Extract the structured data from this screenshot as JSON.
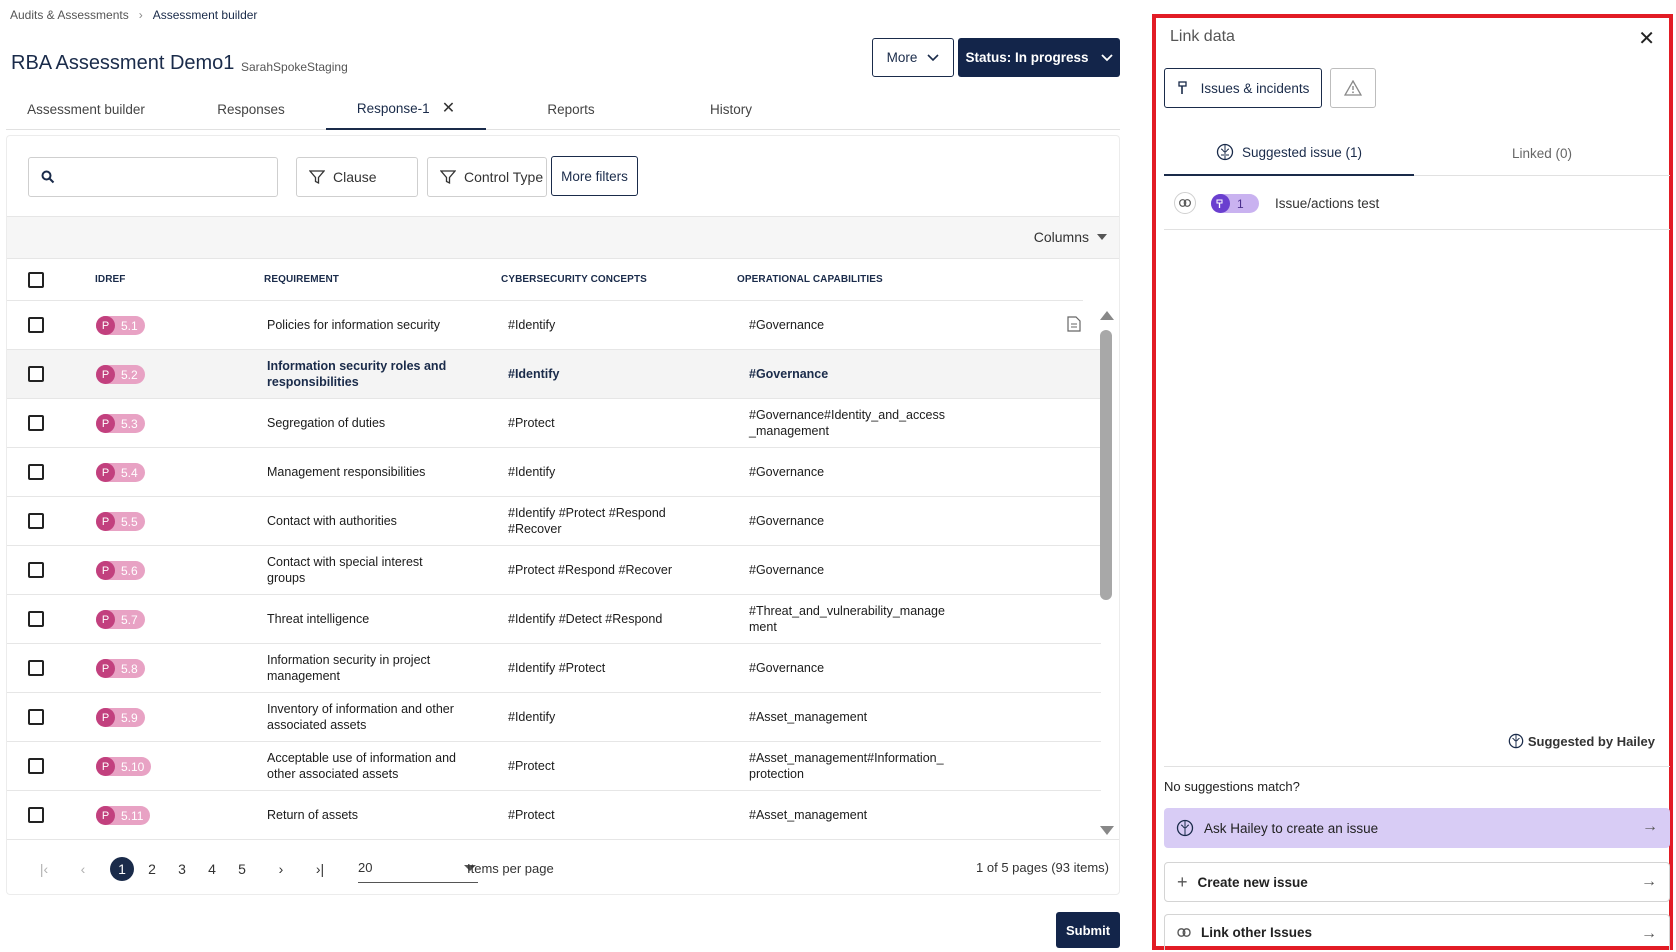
{
  "breadcrumb": {
    "parent": "Audits & Assessments",
    "current": "Assessment builder"
  },
  "page": {
    "title": "RBA Assessment Demo1",
    "subtitle": "SarahSpokeStaging"
  },
  "header_buttons": {
    "more": "More",
    "status": "Status: In progress"
  },
  "tabs": [
    "Assessment builder",
    "Responses",
    "Response-1",
    "Reports",
    "History"
  ],
  "filters": {
    "search_placeholder": "",
    "clause": "Clause",
    "control_type": "Control Type",
    "more_filters": "More filters",
    "columns": "Columns"
  },
  "table": {
    "headers": [
      "IDREF",
      "REQUIREMENT",
      "CYBERSECURITY CONCEPTS",
      "OPERATIONAL CAPABILITIES"
    ],
    "rows": [
      {
        "id": "5.1",
        "req": "Policies for information security",
        "cyber": "#Identify",
        "ops": "#Governance"
      },
      {
        "id": "5.2",
        "req": "Information security roles and responsibilities",
        "cyber": "#Identify",
        "ops": "#Governance"
      },
      {
        "id": "5.3",
        "req": "Segregation of duties",
        "cyber": "#Protect",
        "ops": "#Governance#Identity_and_access_management"
      },
      {
        "id": "5.4",
        "req": "Management responsibilities",
        "cyber": "#Identify",
        "ops": "#Governance"
      },
      {
        "id": "5.5",
        "req": "Contact with authorities",
        "cyber": "#Identify #Protect #Respond #Recover",
        "ops": "#Governance"
      },
      {
        "id": "5.6",
        "req": "Contact with special interest groups",
        "cyber": "#Protect #Respond #Recover",
        "ops": "#Governance"
      },
      {
        "id": "5.7",
        "req": "Threat intelligence",
        "cyber": "#Identify #Detect #Respond",
        "ops": "#Threat_and_vulnerability_management"
      },
      {
        "id": "5.8",
        "req": "Information security in project management",
        "cyber": "#Identify #Protect",
        "ops": "#Governance"
      },
      {
        "id": "5.9",
        "req": "Inventory of information and other associated assets",
        "cyber": "#Identify",
        "ops": "#Asset_management"
      },
      {
        "id": "5.10",
        "req": "Acceptable use of information and other associated assets",
        "cyber": "#Protect",
        "ops": "#Asset_management#Information_protection"
      },
      {
        "id": "5.11",
        "req": "Return of assets",
        "cyber": "#Protect",
        "ops": "#Asset_management"
      }
    ],
    "id_prefix": "P"
  },
  "pagination": {
    "pages": [
      "1",
      "2",
      "3",
      "4",
      "5"
    ],
    "current": "1",
    "per_page": "20",
    "per_page_label": "Items per page",
    "info": "1 of 5 pages (93 items)"
  },
  "submit": "Submit",
  "panel": {
    "title": "Link data",
    "issues_btn": "Issues & incidents",
    "tabs": {
      "suggested": "Suggested issue (1)",
      "linked": "Linked (0)"
    },
    "suggestion": {
      "count": "1",
      "name": "Issue/actions test"
    },
    "suggested_by": "Suggested by Hailey",
    "no_match": "No suggestions match?",
    "actions": {
      "hailey": "Ask Hailey to create an issue",
      "create": "Create new issue",
      "link": "Link other Issues"
    }
  },
  "colors": {
    "navy": "#13254a",
    "pill_pink": "#e8a2c4",
    "pill_dark": "#c2407e",
    "hailey_purple": "#d8ccf5",
    "panel_border": "#e21c25"
  }
}
